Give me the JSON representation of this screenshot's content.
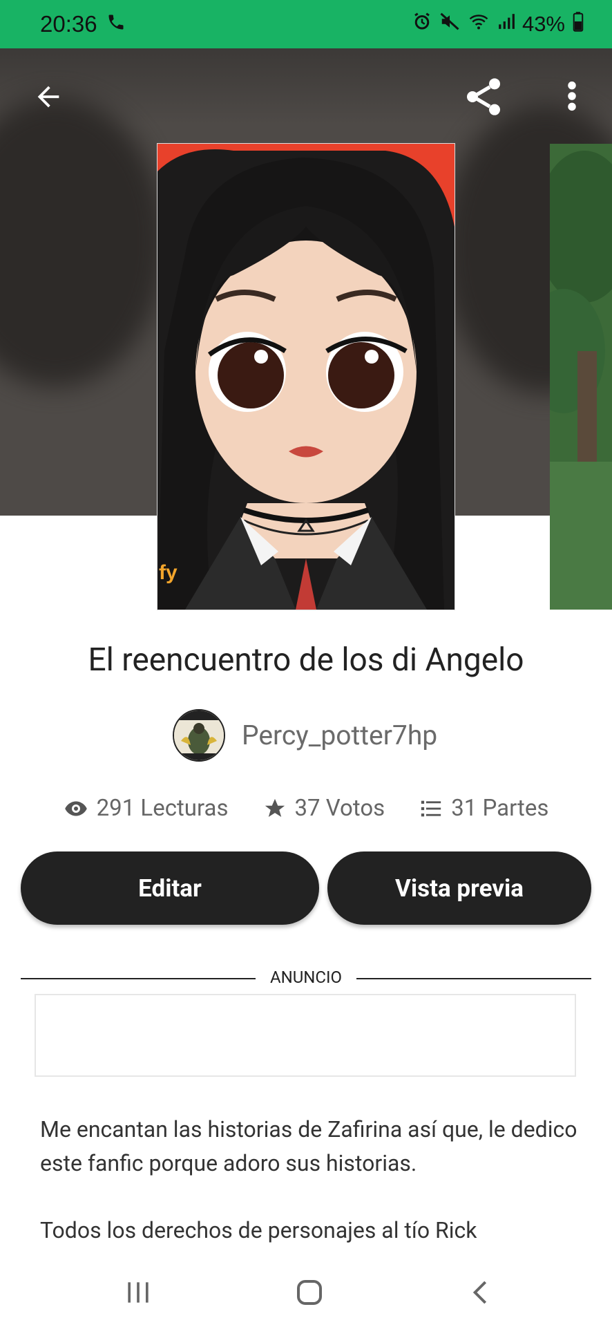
{
  "status_bar": {
    "time": "20:36",
    "battery": "43%"
  },
  "toolbar": {
    "back_icon": "arrow-left-icon",
    "share_icon": "share-icon",
    "more_icon": "more-vertical-icon"
  },
  "story": {
    "title": "El reencuentro de los di Angelo",
    "author": "Percy_potter7hp",
    "cover_watermark": "fy",
    "stats": {
      "reads": "291 Lecturas",
      "votes": "37 Votos",
      "parts": "31 Partes"
    },
    "description": [
      "Me encantan las historias de Zafirina así que, le dedico este fanfic porque adoro sus historias.",
      "Todos los derechos de personajes al tío Rick"
    ]
  },
  "actions": {
    "edit_label": "Editar",
    "preview_label": "Vista previa"
  },
  "ad": {
    "label": "ANUNCIO"
  },
  "colors": {
    "status_bar": "#18b364",
    "button_bg": "#222222",
    "hero_bg": "#4e4a47"
  }
}
